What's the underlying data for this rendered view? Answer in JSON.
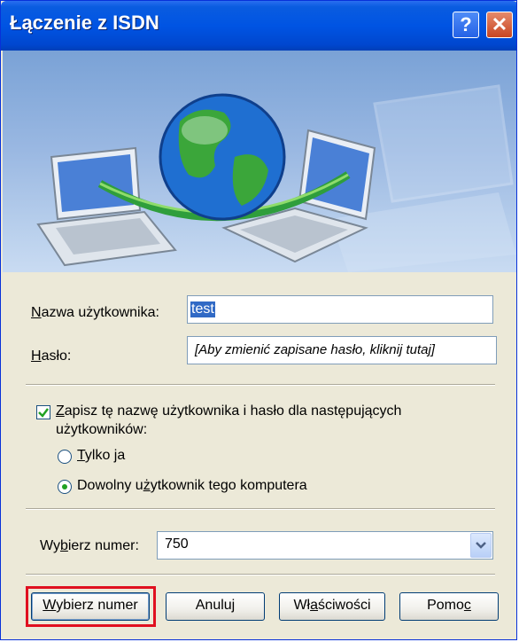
{
  "window": {
    "title": "Łączenie z ISDN",
    "help_glyph": "?",
    "close_glyph": "✕"
  },
  "form": {
    "username_label": "Nazwa użytkownika:",
    "username_value": "test",
    "password_label": "Hasło:",
    "password_placeholder": "[Aby zmienić zapisane hasło, kliknij tutaj]",
    "save_checkbox_label_line1": "Zapisz tę nazwę użytkownika i hasło dla następujących",
    "save_checkbox_label_line2": "użytkowników:",
    "save_checked": true,
    "radio_only_me": "Tylko ja",
    "radio_anyone": "Dowolny użytkownik tego komputera",
    "selected_radio": "anyone",
    "dial_label": "Wybierz numer:",
    "dial_value": "750"
  },
  "buttons": {
    "dial": "Wybierz numer",
    "cancel": "Anuluj",
    "properties": "Właściwości",
    "help": "Pomoc"
  },
  "colors": {
    "titlebar": "#0054e3",
    "highlight": "#e01020",
    "selection": "#316ac5"
  }
}
